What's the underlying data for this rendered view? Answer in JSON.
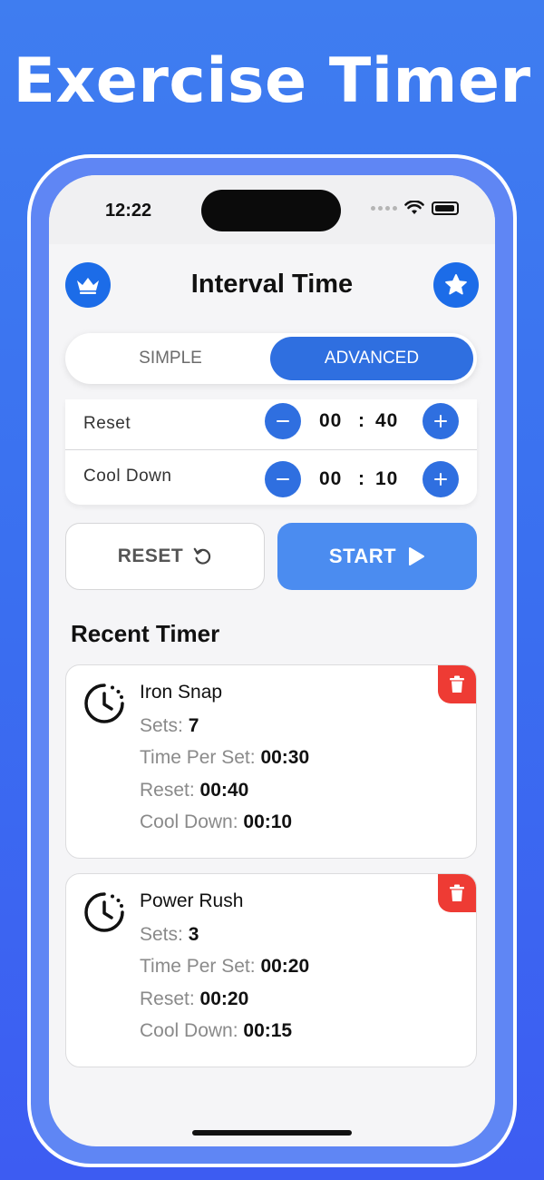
{
  "hero": {
    "title": "Exercise Timer"
  },
  "status_bar": {
    "time": "12:22"
  },
  "header": {
    "title": "Interval Time",
    "left_icon": "crown-icon",
    "right_icon": "star-icon"
  },
  "mode_toggle": {
    "simple_label": "SIMPLE",
    "advanced_label": "ADVANCED",
    "selected": "ADVANCED"
  },
  "settings": [
    {
      "label": "Reset",
      "minutes": "00",
      "separator": ":",
      "seconds": "40"
    },
    {
      "label": "Cool Down",
      "minutes": "00",
      "separator": ":",
      "seconds": "10"
    }
  ],
  "actions": {
    "reset_label": "RESET",
    "start_label": "START"
  },
  "recent": {
    "title": "Recent Timer",
    "timers": [
      {
        "name": "Iron Snap",
        "sets_label": "Sets:",
        "sets": "7",
        "time_per_set_label": "Time Per Set:",
        "time_per_set": "00:30",
        "reset_label": "Reset:",
        "reset": "00:40",
        "cool_down_label": "Cool Down:",
        "cool_down": "00:10"
      },
      {
        "name": "Power Rush",
        "sets_label": "Sets:",
        "sets": "3",
        "time_per_set_label": "Time Per Set:",
        "time_per_set": "00:20",
        "reset_label": "Reset:",
        "reset": "00:20",
        "cool_down_label": "Cool Down:",
        "cool_down": "00:15"
      }
    ]
  },
  "colors": {
    "accent": "#2f6fe0",
    "start": "#4b8cf0",
    "delete": "#ee3b34",
    "background": "#3f7df0"
  }
}
